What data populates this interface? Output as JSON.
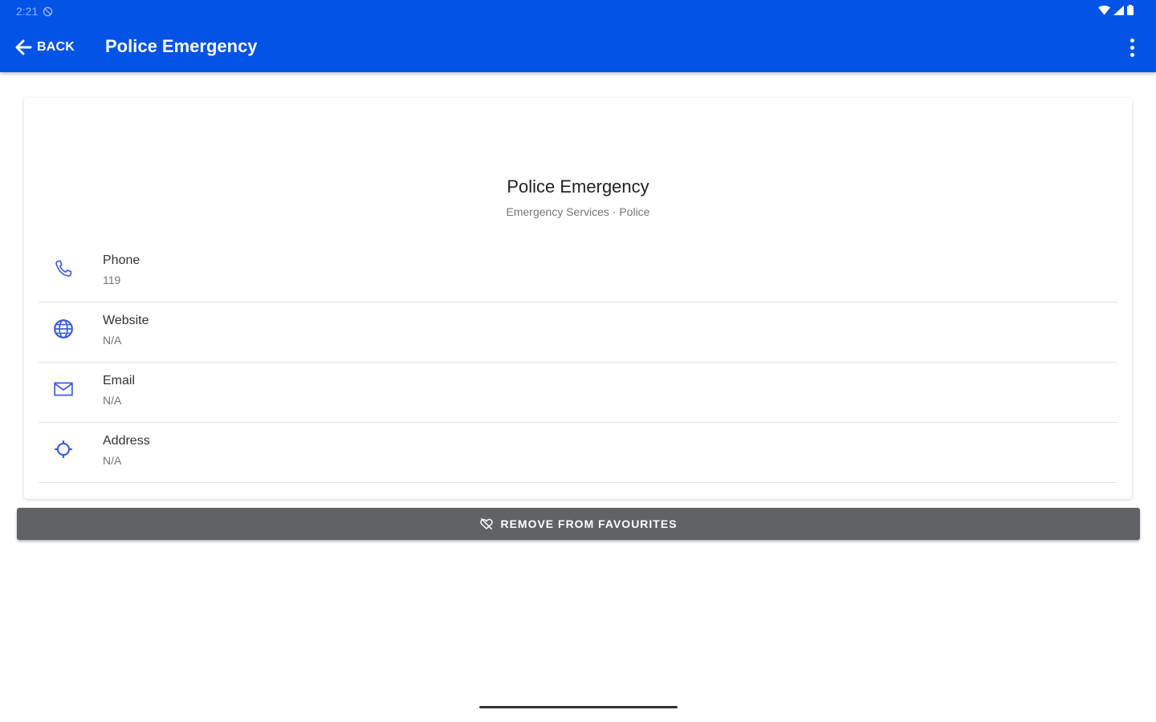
{
  "status_bar": {
    "time": "2:21"
  },
  "app_bar": {
    "back_label": "BACK",
    "title": "Police Emergency"
  },
  "contact": {
    "name": "Police Emergency",
    "category": "Emergency Services · Police",
    "rows": [
      {
        "label": "Phone",
        "value": "119",
        "icon": "phone-icon"
      },
      {
        "label": "Website",
        "value": "N/A",
        "icon": "globe-icon"
      },
      {
        "label": "Email",
        "value": "N/A",
        "icon": "envelope-icon"
      },
      {
        "label": "Address",
        "value": "N/A",
        "icon": "location-icon"
      }
    ]
  },
  "favourites_button": {
    "label": "REMOVE FROM FAVOURITES",
    "icon": "heart-remove-icon"
  },
  "colors": {
    "app_bar": "#0253e6",
    "icon_accent": "#3d5be0",
    "button_background": "#606266"
  }
}
